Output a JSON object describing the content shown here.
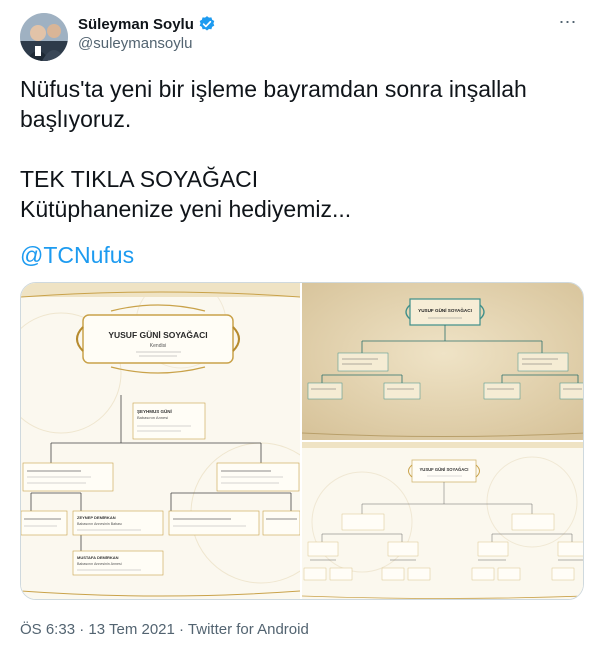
{
  "author": {
    "display_name": "Süleyman Soylu",
    "handle": "@suleymansoylu",
    "verified_icon": "verified-badge-icon",
    "avatar_icon": "profile-avatar"
  },
  "menu": {
    "more_label": "⋯",
    "icon": "more-options-icon"
  },
  "tweet": {
    "text": "Nüfus'ta yeni bir işleme bayramdan sonra inşallah\nbaşlıyoruz.\n\nTEK TIKLA SOYAĞACI\nKütüphanenize yeni hediyemiz...",
    "mention": "@TCNufus"
  },
  "media": {
    "image1": {
      "title": "YUSUF GÜNİ SOYAĞACI",
      "subtitle": "Kendisi",
      "nodes": [
        {
          "name": "ŞEYHMUS GÜNİ",
          "role": "Babasının Annesi"
        },
        {
          "name": "ZEYNEP DEMİRKAN",
          "role": "Babasının Annesinin Babası"
        },
        {
          "name": "MUSTAFA DEMİRKAN",
          "role": "Babasının Annesinin Annesi"
        }
      ]
    },
    "image2": {
      "title": "YUSUF GÜNİ SOYAĞACI"
    },
    "image3": {
      "title": "YUSUF GÜNİ SOYAĞACI"
    }
  },
  "meta": {
    "time": "ÖS 6:33",
    "separator1": " · ",
    "date": "13 Tem 2021",
    "separator2": " · ",
    "source": "Twitter for Android"
  },
  "colors": {
    "link": "#1d9bf0",
    "verified": "#1d9bf0",
    "secondary_text": "#536471",
    "parchment": "#e6d7b6",
    "gold": "#c9a24a",
    "teal": "#3e8f8a"
  }
}
